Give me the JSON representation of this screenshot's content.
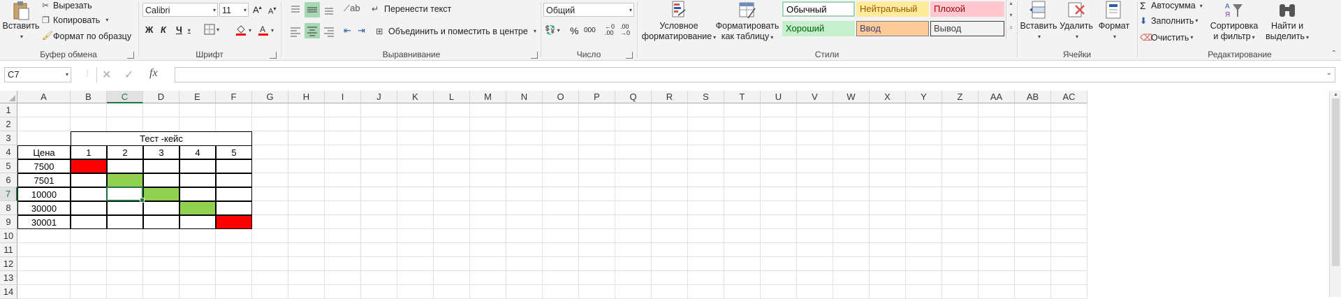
{
  "ribbon": {
    "clipboard": {
      "label": "Буфер обмена",
      "paste": "Вставить",
      "cut": "Вырезать",
      "copy": "Копировать",
      "format_painter": "Формат по образцу"
    },
    "font": {
      "label": "Шрифт",
      "name": "Calibri",
      "size": "11",
      "bold": "Ж",
      "italic": "К",
      "underline": "Ч"
    },
    "alignment": {
      "label": "Выравнивание",
      "wrap": "Перенести текст",
      "merge": "Объединить и поместить в центре"
    },
    "number": {
      "label": "Число",
      "format": "Общий",
      "percent": "%",
      "thousands": "000"
    },
    "styles": {
      "label": "Стили",
      "conditional": [
        "Условное",
        "форматирование"
      ],
      "as_table": [
        "Форматировать",
        "как таблицу"
      ],
      "gallery": [
        {
          "text": "Обычный",
          "bg": "#ffffff",
          "fg": "#000000",
          "border": "#9fd6b7"
        },
        {
          "text": "Нейтральный",
          "bg": "#ffeb9c",
          "fg": "#9c5700",
          "border": "#ffeb9c"
        },
        {
          "text": "Плохой",
          "bg": "#ffc7ce",
          "fg": "#9c0006",
          "border": "#ffc7ce"
        },
        {
          "text": "Хороший",
          "bg": "#c6efce",
          "fg": "#006100",
          "border": "#c6efce"
        },
        {
          "text": "Ввод",
          "bg": "#ffcc99",
          "fg": "#3f3f76",
          "border": "#7f7f7f"
        },
        {
          "text": "Вывод",
          "bg": "#f2f2f2",
          "fg": "#3f3f3f",
          "border": "#3f3f3f"
        }
      ]
    },
    "cells": {
      "label": "Ячейки",
      "insert": "Вставить",
      "delete": "Удалить",
      "format": "Формат"
    },
    "editing": {
      "label": "Редактирование",
      "autosum": "Автосумма",
      "fill": "Заполнить",
      "clear": "Очистить",
      "sort": [
        "Сортировка",
        "и фильтр"
      ],
      "find": [
        "Найти и",
        "выделить"
      ]
    }
  },
  "formula_bar": {
    "name_box": "C7",
    "fx": "fx",
    "value": ""
  },
  "sheet": {
    "columns": [
      "A",
      "B",
      "C",
      "D",
      "E",
      "F",
      "G",
      "H",
      "I",
      "J",
      "K",
      "L",
      "M",
      "N",
      "O",
      "P",
      "Q",
      "R",
      "S",
      "T",
      "U",
      "V",
      "W",
      "X",
      "Y",
      "Z",
      "AA",
      "AB",
      "AC"
    ],
    "rows": [
      "1",
      "2",
      "3",
      "4",
      "5",
      "6",
      "7",
      "8",
      "9",
      "10",
      "11",
      "12",
      "13",
      "14"
    ],
    "selected_cell": "C7",
    "table_title": "Тест -кейс",
    "header_label": "Цена",
    "case_numbers": [
      "1",
      "2",
      "3",
      "4",
      "5"
    ],
    "prices": [
      "7500",
      "7501",
      "10000",
      "30000",
      "30001"
    ],
    "fills": [
      {
        "row": 0,
        "col": 0,
        "color": "#ff0000"
      },
      {
        "row": 1,
        "col": 1,
        "color": "#92d050"
      },
      {
        "row": 2,
        "col": 2,
        "color": "#92d050"
      },
      {
        "row": 3,
        "col": 3,
        "color": "#92d050"
      },
      {
        "row": 4,
        "col": 4,
        "color": "#ff0000"
      }
    ]
  },
  "colors": {
    "accent": "#217346"
  }
}
